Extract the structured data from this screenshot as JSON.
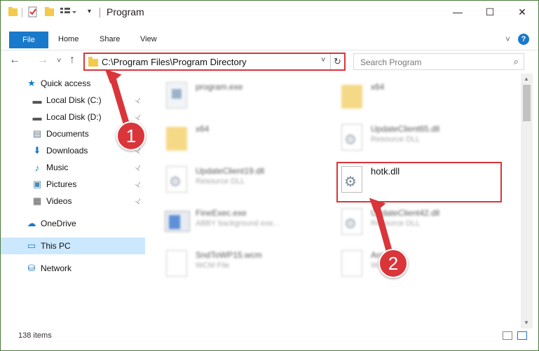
{
  "titlebar": {
    "title": "Program",
    "minimize": "—",
    "maximize": "☐",
    "close": "✕"
  },
  "ribbon": {
    "file": "File",
    "tabs": [
      "Home",
      "Share",
      "View"
    ],
    "expand": "˅",
    "help": "?"
  },
  "nav": {
    "back": "←",
    "forward": "→",
    "recent": "˅",
    "up": "↑",
    "address": "C:\\Program Files\\Program Directory",
    "address_dropdown": "˅",
    "refresh": "↻",
    "search_placeholder": "Search Program",
    "search_icon": "⌕"
  },
  "sidebar": {
    "items": [
      {
        "label": "Quick access",
        "icon": "star-icon",
        "glyph": "★",
        "color": "#1979ca",
        "pinned": false
      },
      {
        "label": "Local Disk (C:)",
        "icon": "drive-icon",
        "glyph": "▬",
        "color": "#555555",
        "pinned": true
      },
      {
        "label": "Local Disk (D:)",
        "icon": "drive-icon",
        "glyph": "▬",
        "color": "#555555",
        "pinned": true
      },
      {
        "label": "Documents",
        "icon": "documents-icon",
        "glyph": "▤",
        "color": "#6b7b8b",
        "pinned": true
      },
      {
        "label": "Downloads",
        "icon": "download-icon",
        "glyph": "⬇",
        "color": "#1979ca",
        "pinned": true
      },
      {
        "label": "Music",
        "icon": "music-icon",
        "glyph": "♪",
        "color": "#1979ca",
        "pinned": true
      },
      {
        "label": "Pictures",
        "icon": "pictures-icon",
        "glyph": "▣",
        "color": "#4a8ab0",
        "pinned": true
      },
      {
        "label": "Videos",
        "icon": "videos-icon",
        "glyph": "▦",
        "color": "#555555",
        "pinned": true
      },
      {
        "label": "OneDrive",
        "icon": "cloud-icon",
        "glyph": "☁",
        "color": "#1979ca",
        "pinned": false
      },
      {
        "label": "This PC",
        "icon": "computer-icon",
        "glyph": "▭",
        "color": "#1979ca",
        "pinned": false,
        "selected": true
      },
      {
        "label": "Network",
        "icon": "network-icon",
        "glyph": "⛁",
        "color": "#1979ca",
        "pinned": false
      }
    ],
    "pin_glyph": "📌"
  },
  "files": [
    {
      "name": "program.exe",
      "sub": "",
      "blurred": true
    },
    {
      "name": "x64",
      "sub": "",
      "blurred": true
    },
    {
      "name": "x64",
      "sub": "",
      "blurred": true
    },
    {
      "name": "UpdateClient65.dll",
      "sub": "Resource DLL",
      "blurred": true
    },
    {
      "name": "UpdateClient19.dll",
      "sub": "Resource DLL",
      "blurred": true
    },
    {
      "name": "hotk.dll",
      "sub": "",
      "blurred": false
    },
    {
      "name": "FineExec.exe",
      "sub": "ABBY background exe...",
      "blurred": true
    },
    {
      "name": "UpdateClient42.dll",
      "sub": "Resource DLL",
      "blurred": true
    },
    {
      "name": "SndToWP15.wcm",
      "sub": "WCM File",
      "blurred": true
    },
    {
      "name": "Arc...ard",
      "sub": "W...",
      "blurred": true
    }
  ],
  "annotations": {
    "step1": "1",
    "step2": "2"
  },
  "status": {
    "items": "138 items"
  },
  "colors": {
    "accent": "#1979ca",
    "highlight": "#d9353a",
    "selected": "#cce8ff"
  }
}
